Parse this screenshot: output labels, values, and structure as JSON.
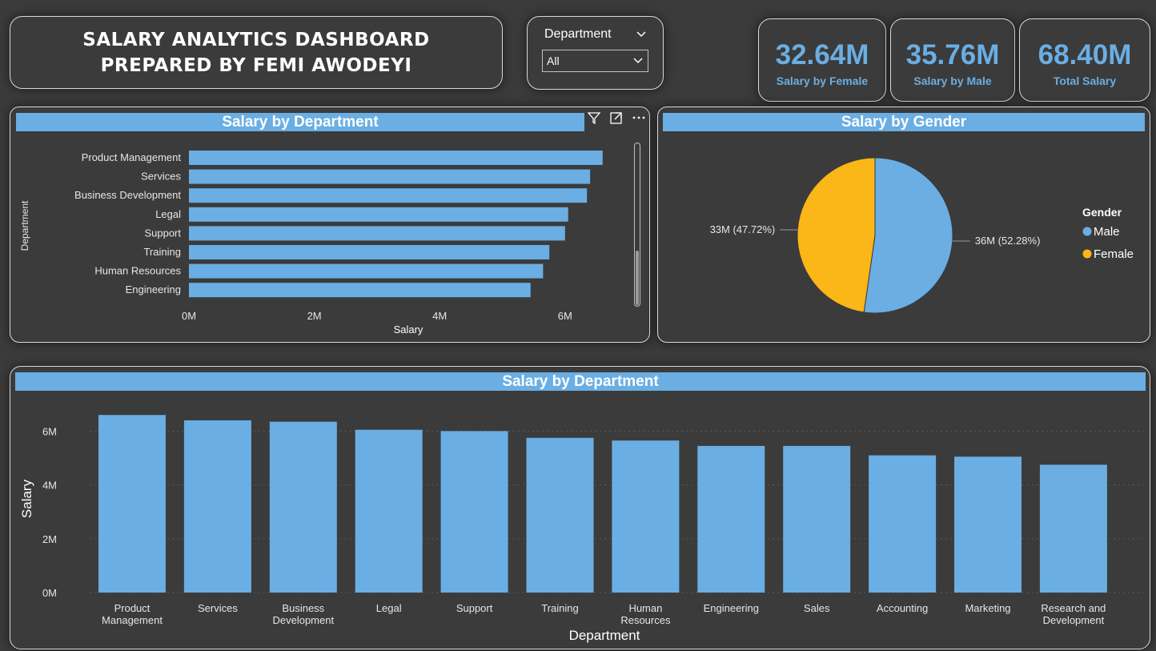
{
  "header": {
    "title_line1": "SALARY ANALYTICS DASHBOARD",
    "title_line2": "PREPARED BY FEMI AWODEYI"
  },
  "slicer": {
    "label": "Department",
    "selected": "All"
  },
  "kpis": [
    {
      "value": "32.64M",
      "label": "Salary by Female"
    },
    {
      "value": "35.76M",
      "label": "Salary by Male"
    },
    {
      "value": "68.40M",
      "label": "Total Salary"
    }
  ],
  "colors": {
    "accent": "#6aaee3",
    "female": "#fbb617",
    "background": "#3b3b3b"
  },
  "chart_data": [
    {
      "type": "bar",
      "orientation": "horizontal",
      "title": "Salary by Department",
      "xlabel": "Salary",
      "ylabel": "Department",
      "categories": [
        "Product Management",
        "Services",
        "Business Development",
        "Legal",
        "Support",
        "Training",
        "Human Resources",
        "Engineering"
      ],
      "values": [
        6.6,
        6.4,
        6.35,
        6.05,
        6.0,
        5.75,
        5.65,
        5.45
      ],
      "xticks": [
        "0M",
        "2M",
        "4M",
        "6M"
      ],
      "xlim": [
        0,
        6.6
      ]
    },
    {
      "type": "pie",
      "title": "Salary by Gender",
      "legend_title": "Gender",
      "legend_position": "right",
      "slices": [
        {
          "label": "Male",
          "value": 52.28,
          "data_label": "36M (52.28%)",
          "color": "#6aaee3"
        },
        {
          "label": "Female",
          "value": 47.72,
          "data_label": "33M (47.72%)",
          "color": "#fbb617"
        }
      ]
    },
    {
      "type": "bar",
      "orientation": "vertical",
      "title": "Salary by Department",
      "xlabel": "Department",
      "ylabel": "Salary",
      "categories": [
        "Product Management",
        "Services",
        "Business Development",
        "Legal",
        "Support",
        "Training",
        "Human Resources",
        "Engineering",
        "Sales",
        "Accounting",
        "Marketing",
        "Research and Development"
      ],
      "category_lines": [
        [
          "Product",
          "Management"
        ],
        [
          "Services"
        ],
        [
          "Business",
          "Development"
        ],
        [
          "Legal"
        ],
        [
          "Support"
        ],
        [
          "Training"
        ],
        [
          "Human",
          "Resources"
        ],
        [
          "Engineering"
        ],
        [
          "Sales"
        ],
        [
          "Accounting"
        ],
        [
          "Marketing"
        ],
        [
          "Research and",
          "Development"
        ]
      ],
      "values": [
        6.6,
        6.4,
        6.35,
        6.05,
        6.0,
        5.75,
        5.65,
        5.45,
        5.45,
        5.1,
        5.05,
        4.75
      ],
      "yticks": [
        "0M",
        "2M",
        "4M",
        "6M"
      ],
      "ylim": [
        0,
        6.6
      ],
      "grid": true
    }
  ]
}
